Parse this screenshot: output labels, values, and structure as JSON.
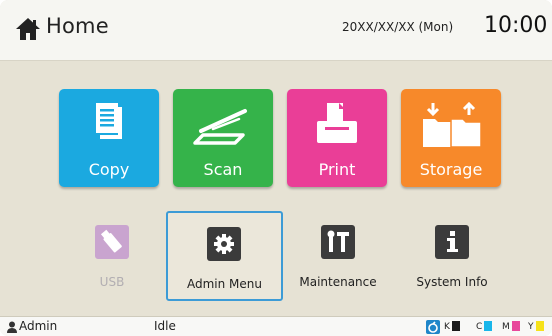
{
  "header": {
    "title": "Home",
    "date": "20XX/XX/XX (Mon)",
    "time": "10:00"
  },
  "tiles": [
    {
      "label": "Copy",
      "color": "#1ba9e0",
      "icon": "document-icon"
    },
    {
      "label": "Scan",
      "color": "#35b34a",
      "icon": "scanner-icon"
    },
    {
      "label": "Print",
      "color": "#ea3e97",
      "icon": "print-icon"
    },
    {
      "label": "Storage",
      "color": "#f7892a",
      "icon": "folder-transfer-icon"
    }
  ],
  "buttons": [
    {
      "label": "USB",
      "icon": "usb-icon",
      "disabled": true
    },
    {
      "label": "Admin Menu",
      "icon": "gear-icon",
      "selected": true
    },
    {
      "label": "Maintenance",
      "icon": "tools-icon"
    },
    {
      "label": "System Info",
      "icon": "info-icon"
    }
  ],
  "status_bar": {
    "user": "Admin",
    "state": "Idle",
    "inks": [
      {
        "letter": "K",
        "color": "#1a1a1a"
      },
      {
        "letter": "C",
        "color": "#19b6ea"
      },
      {
        "letter": "M",
        "color": "#e8489b"
      },
      {
        "letter": "Y",
        "color": "#f6e21a"
      }
    ]
  }
}
